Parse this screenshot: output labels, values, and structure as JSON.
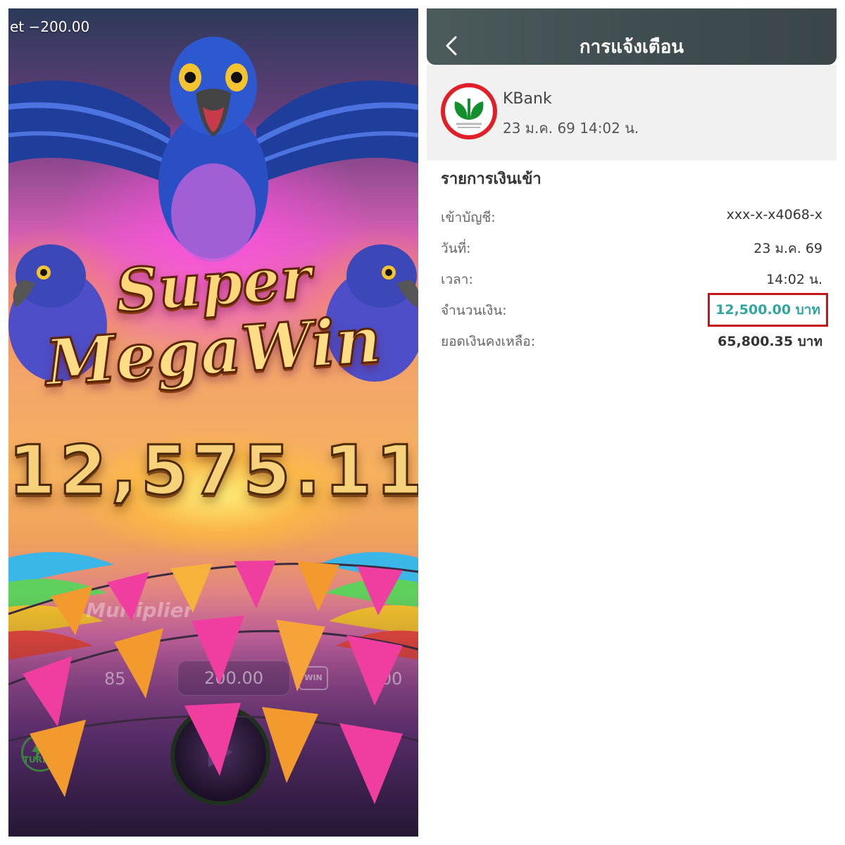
{
  "game": {
    "bet_text": "et −200.00",
    "win_title_line1": "Super",
    "win_title_line2": "MegaWin",
    "win_amount": "12,575.11",
    "hud": {
      "multiplier_text": "Multiplier",
      "left_value": "85",
      "bet_value": "200.00",
      "win_icon_label": "WIN",
      "win_value": "0.00",
      "turbo_label": "TURBO"
    },
    "colors": {
      "title_gold": "#ffd77a",
      "amount_gold": "#f8d27a",
      "parrot_blue": "#2a4fc4",
      "beak": "#444444"
    }
  },
  "bank": {
    "header_title": "การแจ้งเตือน",
    "sender_name": "KBank",
    "sender_time": "23 ม.ค. 69   14:02 น.",
    "section_title": "รายการเงินเข้า",
    "rows": [
      {
        "label": "เข้าบัญชี:",
        "value": "xxx-x-x4068-x"
      },
      {
        "label": "วันที่:",
        "value": "23 ม.ค. 69"
      },
      {
        "label": "เวลา:",
        "value": "14:02 น."
      },
      {
        "label": "จำนวนเงิน:",
        "value": "12,500.00 บาท"
      },
      {
        "label": "ยอดเงินคงเหลือ:",
        "value": "65,800.35 บาท"
      }
    ],
    "colors": {
      "header_bg": "#404e51",
      "highlight_border": "#c4161c",
      "amount_text": "#31a5a0",
      "kbank_green": "#138f2d",
      "kbank_red": "#e11f26"
    },
    "icons": {
      "back": "chevron-left-icon",
      "logo": "kbank-logo-icon"
    }
  }
}
